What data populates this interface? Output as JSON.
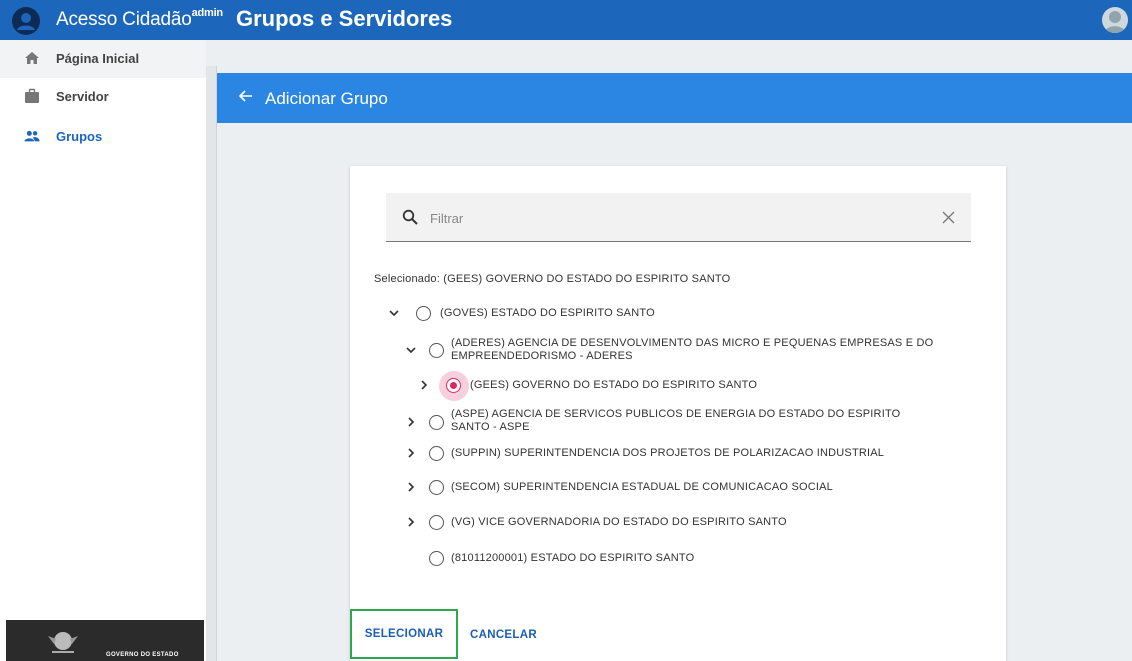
{
  "appbar": {
    "app_name": "Acesso Cidadão",
    "app_badge": "admin",
    "page_title": "Grupos e Servidores"
  },
  "sidebar": {
    "items": [
      {
        "label": "Página Inicial",
        "icon": "home-icon"
      },
      {
        "label": "Servidor",
        "icon": "briefcase-icon"
      },
      {
        "label": "Grupos",
        "icon": "people-icon",
        "active": true
      }
    ],
    "footer_text": "GOVERNO DO ESTADO"
  },
  "subheader": {
    "title": "Adicionar Grupo"
  },
  "filter": {
    "placeholder": "Filtrar",
    "value": ""
  },
  "selected_label": "Selecionado: (GEES) GOVERNO DO ESTADO DO ESPIRITO SANTO",
  "tree": [
    {
      "label": "(GOVES) ESTADO DO ESPIRITO SANTO",
      "chevron": "down",
      "selected": false
    },
    {
      "label_1": "(ADERES) AGENCIA DE DESENVOLVIMENTO DAS MICRO E PEQUENAS EMPRESAS E DO",
      "label_2": "EMPREENDEDORISMO - ADERES",
      "chevron": "down",
      "selected": false
    },
    {
      "label": "(GEES) GOVERNO DO ESTADO DO ESPIRITO SANTO",
      "chevron": "right",
      "selected": true
    },
    {
      "label_1": "(ASPE) AGENCIA DE SERVICOS PUBLICOS DE ENERGIA DO ESTADO DO ESPIRITO",
      "label_2": "SANTO - ASPE",
      "chevron": "right",
      "selected": false
    },
    {
      "label": "(SUPPIN) SUPERINTENDENCIA DOS PROJETOS DE POLARIZACAO INDUSTRIAL",
      "chevron": "right",
      "selected": false
    },
    {
      "label": "(SECOM) SUPERINTENDENCIA ESTADUAL DE COMUNICACAO SOCIAL",
      "chevron": "right",
      "selected": false
    },
    {
      "label": "(VG) VICE GOVERNADORIA DO ESTADO DO ESPIRITO SANTO",
      "chevron": "right",
      "selected": false
    },
    {
      "label": "(81011200001) ESTADO DO ESPIRITO SANTO",
      "chevron": "none",
      "selected": false
    }
  ],
  "actions": {
    "select_label": "SELECIONAR",
    "cancel_label": "CANCELAR"
  },
  "colors": {
    "appbar": "#1c67bc",
    "subheader": "#2b86e3",
    "radio_selected": "#e0245e",
    "button_text": "#1a5fb4",
    "focus_outline": "#2ea84f"
  }
}
